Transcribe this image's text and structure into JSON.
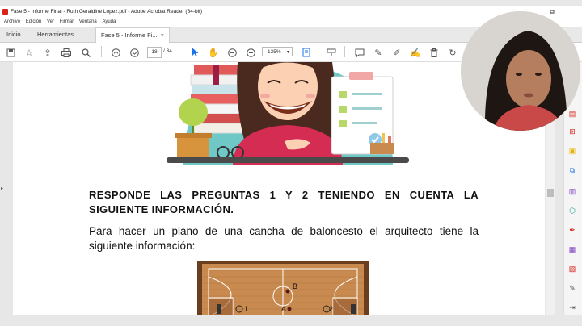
{
  "window": {
    "title": "Fase 5 - Informe Final - Ruth Geraldine Lopez.pdf - Adobe Acrobat Reader (64-bit)"
  },
  "menu": [
    "Archivo",
    "Edición",
    "Ver",
    "Firmar",
    "Ventana",
    "Ayuda"
  ],
  "tabs": {
    "home": "Inicio",
    "tools": "Herramientas",
    "document": "Fase 5 - Informe Fi...",
    "close": "×"
  },
  "toolbar": {
    "page_current": "18",
    "page_total": "/ 34",
    "zoom": "135%",
    "zoom_arrow": "▾"
  },
  "document": {
    "heading": "RESPONDE LAS PREGUNTAS 1 Y 2 TENIENDO EN CUENTA LA SIGUIENTE INFORMACIÓN.",
    "body": "Para hacer un plano de una cancha de baloncesto el arquitecto tiene la siguiente información:",
    "court_labels": {
      "a": "A",
      "b": "B",
      "one": "1",
      "two": "2"
    }
  },
  "colors": {
    "acrobat_red": "#d9241b",
    "court_wood": "#c98a4f",
    "accent_blue": "#1a73e8"
  }
}
